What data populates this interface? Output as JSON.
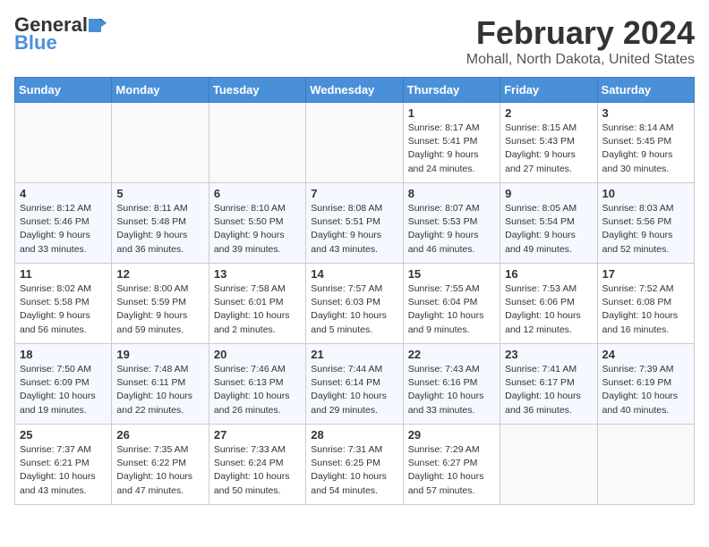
{
  "app": {
    "name": "GeneralBlue",
    "logo_text_line1": "General",
    "logo_text_line2": "Blue"
  },
  "calendar": {
    "month_year": "February 2024",
    "location": "Mohall, North Dakota, United States",
    "days_of_week": [
      "Sunday",
      "Monday",
      "Tuesday",
      "Wednesday",
      "Thursday",
      "Friday",
      "Saturday"
    ],
    "weeks": [
      [
        {
          "day": "",
          "sunrise": "",
          "sunset": "",
          "daylight": ""
        },
        {
          "day": "",
          "sunrise": "",
          "sunset": "",
          "daylight": ""
        },
        {
          "day": "",
          "sunrise": "",
          "sunset": "",
          "daylight": ""
        },
        {
          "day": "",
          "sunrise": "",
          "sunset": "",
          "daylight": ""
        },
        {
          "day": "1",
          "sunrise": "Sunrise: 8:17 AM",
          "sunset": "Sunset: 5:41 PM",
          "daylight": "Daylight: 9 hours and 24 minutes."
        },
        {
          "day": "2",
          "sunrise": "Sunrise: 8:15 AM",
          "sunset": "Sunset: 5:43 PM",
          "daylight": "Daylight: 9 hours and 27 minutes."
        },
        {
          "day": "3",
          "sunrise": "Sunrise: 8:14 AM",
          "sunset": "Sunset: 5:45 PM",
          "daylight": "Daylight: 9 hours and 30 minutes."
        }
      ],
      [
        {
          "day": "4",
          "sunrise": "Sunrise: 8:12 AM",
          "sunset": "Sunset: 5:46 PM",
          "daylight": "Daylight: 9 hours and 33 minutes."
        },
        {
          "day": "5",
          "sunrise": "Sunrise: 8:11 AM",
          "sunset": "Sunset: 5:48 PM",
          "daylight": "Daylight: 9 hours and 36 minutes."
        },
        {
          "day": "6",
          "sunrise": "Sunrise: 8:10 AM",
          "sunset": "Sunset: 5:50 PM",
          "daylight": "Daylight: 9 hours and 39 minutes."
        },
        {
          "day": "7",
          "sunrise": "Sunrise: 8:08 AM",
          "sunset": "Sunset: 5:51 PM",
          "daylight": "Daylight: 9 hours and 43 minutes."
        },
        {
          "day": "8",
          "sunrise": "Sunrise: 8:07 AM",
          "sunset": "Sunset: 5:53 PM",
          "daylight": "Daylight: 9 hours and 46 minutes."
        },
        {
          "day": "9",
          "sunrise": "Sunrise: 8:05 AM",
          "sunset": "Sunset: 5:54 PM",
          "daylight": "Daylight: 9 hours and 49 minutes."
        },
        {
          "day": "10",
          "sunrise": "Sunrise: 8:03 AM",
          "sunset": "Sunset: 5:56 PM",
          "daylight": "Daylight: 9 hours and 52 minutes."
        }
      ],
      [
        {
          "day": "11",
          "sunrise": "Sunrise: 8:02 AM",
          "sunset": "Sunset: 5:58 PM",
          "daylight": "Daylight: 9 hours and 56 minutes."
        },
        {
          "day": "12",
          "sunrise": "Sunrise: 8:00 AM",
          "sunset": "Sunset: 5:59 PM",
          "daylight": "Daylight: 9 hours and 59 minutes."
        },
        {
          "day": "13",
          "sunrise": "Sunrise: 7:58 AM",
          "sunset": "Sunset: 6:01 PM",
          "daylight": "Daylight: 10 hours and 2 minutes."
        },
        {
          "day": "14",
          "sunrise": "Sunrise: 7:57 AM",
          "sunset": "Sunset: 6:03 PM",
          "daylight": "Daylight: 10 hours and 5 minutes."
        },
        {
          "day": "15",
          "sunrise": "Sunrise: 7:55 AM",
          "sunset": "Sunset: 6:04 PM",
          "daylight": "Daylight: 10 hours and 9 minutes."
        },
        {
          "day": "16",
          "sunrise": "Sunrise: 7:53 AM",
          "sunset": "Sunset: 6:06 PM",
          "daylight": "Daylight: 10 hours and 12 minutes."
        },
        {
          "day": "17",
          "sunrise": "Sunrise: 7:52 AM",
          "sunset": "Sunset: 6:08 PM",
          "daylight": "Daylight: 10 hours and 16 minutes."
        }
      ],
      [
        {
          "day": "18",
          "sunrise": "Sunrise: 7:50 AM",
          "sunset": "Sunset: 6:09 PM",
          "daylight": "Daylight: 10 hours and 19 minutes."
        },
        {
          "day": "19",
          "sunrise": "Sunrise: 7:48 AM",
          "sunset": "Sunset: 6:11 PM",
          "daylight": "Daylight: 10 hours and 22 minutes."
        },
        {
          "day": "20",
          "sunrise": "Sunrise: 7:46 AM",
          "sunset": "Sunset: 6:13 PM",
          "daylight": "Daylight: 10 hours and 26 minutes."
        },
        {
          "day": "21",
          "sunrise": "Sunrise: 7:44 AM",
          "sunset": "Sunset: 6:14 PM",
          "daylight": "Daylight: 10 hours and 29 minutes."
        },
        {
          "day": "22",
          "sunrise": "Sunrise: 7:43 AM",
          "sunset": "Sunset: 6:16 PM",
          "daylight": "Daylight: 10 hours and 33 minutes."
        },
        {
          "day": "23",
          "sunrise": "Sunrise: 7:41 AM",
          "sunset": "Sunset: 6:17 PM",
          "daylight": "Daylight: 10 hours and 36 minutes."
        },
        {
          "day": "24",
          "sunrise": "Sunrise: 7:39 AM",
          "sunset": "Sunset: 6:19 PM",
          "daylight": "Daylight: 10 hours and 40 minutes."
        }
      ],
      [
        {
          "day": "25",
          "sunrise": "Sunrise: 7:37 AM",
          "sunset": "Sunset: 6:21 PM",
          "daylight": "Daylight: 10 hours and 43 minutes."
        },
        {
          "day": "26",
          "sunrise": "Sunrise: 7:35 AM",
          "sunset": "Sunset: 6:22 PM",
          "daylight": "Daylight: 10 hours and 47 minutes."
        },
        {
          "day": "27",
          "sunrise": "Sunrise: 7:33 AM",
          "sunset": "Sunset: 6:24 PM",
          "daylight": "Daylight: 10 hours and 50 minutes."
        },
        {
          "day": "28",
          "sunrise": "Sunrise: 7:31 AM",
          "sunset": "Sunset: 6:25 PM",
          "daylight": "Daylight: 10 hours and 54 minutes."
        },
        {
          "day": "29",
          "sunrise": "Sunrise: 7:29 AM",
          "sunset": "Sunset: 6:27 PM",
          "daylight": "Daylight: 10 hours and 57 minutes."
        },
        {
          "day": "",
          "sunrise": "",
          "sunset": "",
          "daylight": ""
        },
        {
          "day": "",
          "sunrise": "",
          "sunset": "",
          "daylight": ""
        }
      ]
    ]
  }
}
